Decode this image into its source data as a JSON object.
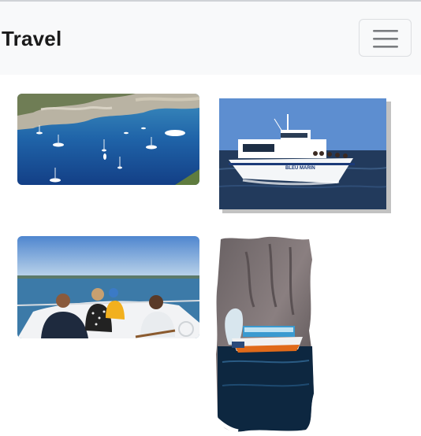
{
  "navbar": {
    "brand": "Travel",
    "toggler_icon": "hamburger-menu-icon"
  },
  "gallery": {
    "images": [
      {
        "name": "calanques-bay-yachts",
        "subject": "Bay with anchored sailboats and rocky cliffs"
      },
      {
        "name": "bleu-marin-boat",
        "subject": "White passenger boat on the sea",
        "boat_name": "BLEU MARIN"
      },
      {
        "name": "boat-passengers",
        "subject": "Passengers seated on the bow of a boat"
      },
      {
        "name": "rock-arch-boat",
        "subject": "Tour boat passing a rock arch"
      }
    ]
  },
  "colors": {
    "navbar_bg": "#f8f9fa",
    "brand_text": "#1a1a1a",
    "toggler_border": "#dcdee1",
    "sea_blue": "#1d5a9a"
  }
}
